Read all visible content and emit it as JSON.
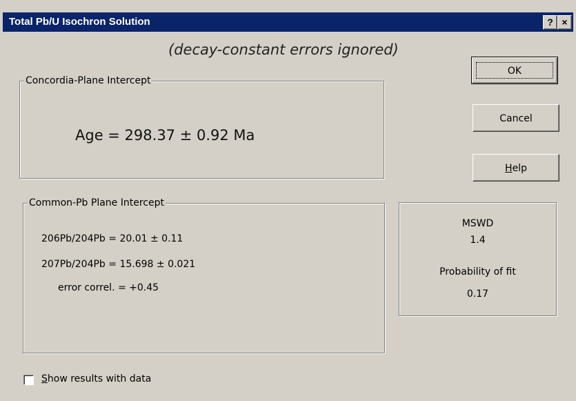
{
  "window": {
    "title": "Total Pb/U Isochron Solution",
    "help_button": "?",
    "close_button": "×"
  },
  "subtitle": "(decay-constant errors ignored)",
  "concordia": {
    "legend": "Concordia-Plane Intercept",
    "age_text": "Age = 298.37 ± 0.92 Ma"
  },
  "common_pb": {
    "legend": "Common-Pb Plane Intercept",
    "line1": "206Pb/204Pb = 20.01 ± 0.11",
    "line2": "207Pb/204Pb = 15.698 ± 0.021",
    "line3": "error correl. = +0.45"
  },
  "stats": {
    "mswd_label": "MSWD",
    "mswd_value": "1.4",
    "prob_label": "Probability of fit",
    "prob_value": "0.17"
  },
  "buttons": {
    "ok": "OK",
    "cancel": "Cancel",
    "help_first": "H",
    "help_rest": "elp"
  },
  "checkbox": {
    "label_first": "S",
    "label_rest": "how results with data",
    "checked": false
  },
  "colors": {
    "titlebar": "#0a246a",
    "face": "#d4d0c8"
  }
}
